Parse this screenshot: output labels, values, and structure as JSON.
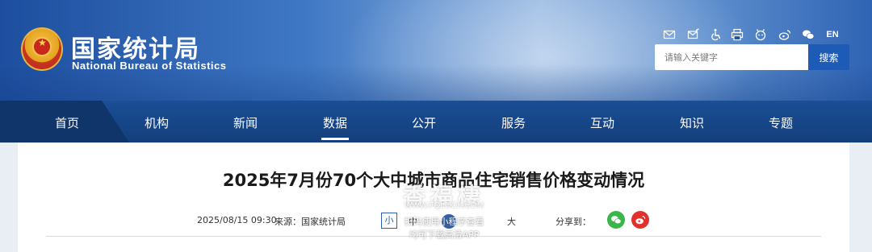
{
  "header": {
    "logo_cn": "国家统计局",
    "logo_en": "National Bureau of Statistics",
    "tools": {
      "mail_icon": "mail-icon",
      "feedback_icon": "mail-edit-icon",
      "accessibility_icon": "accessibility-icon",
      "print_icon": "print-icon",
      "app_icon": "app-icon",
      "weibo_icon": "weibo-icon",
      "wechat_icon": "wechat-icon",
      "lang_label": "EN"
    },
    "search": {
      "placeholder": "请输入关键字",
      "button_label": "搜索"
    }
  },
  "nav": {
    "items": [
      "首页",
      "机构",
      "新闻",
      "数据",
      "公开",
      "服务",
      "互动",
      "知识",
      "专题"
    ],
    "active": "数据"
  },
  "article": {
    "title": "2025年7月份70个大中城市商品住宅销售价格变动情况",
    "date": "2025/08/15 09:30",
    "source": "来源：国家统计局",
    "font_small": "小",
    "font_medium": "中",
    "font_large": "大",
    "share_label": "分享到："
  },
  "watermark": {
    "mark": "香福棲",
    "url": "WWW.FQLOOK.COM",
    "line1": "扫码使用小程序查看",
    "line2": "均可下载高清APP"
  },
  "colors": {
    "nav_bg": "#1a4e96",
    "search_button": "#1e5bb7",
    "wechat_green": "#3ab54a",
    "weibo_red": "#e2312d"
  }
}
